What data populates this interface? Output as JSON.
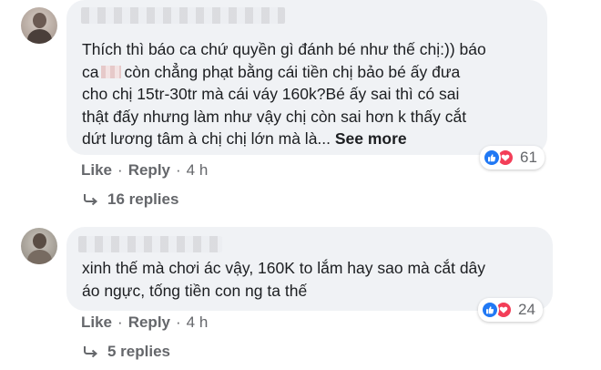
{
  "comments": [
    {
      "author_blurred": true,
      "text_part1": "Thích thì báo ca chứ quyền gì đánh bé như thế chị:)) báo\nca",
      "text_part2": "còn chẳng phạt bằng cái tiền chị bảo bé ấy đưa\ncho chị 15tr-30tr mà cái váy 160k?Bé ấy sai thì có sai\nthật đấy nhưng làm như vậy chị còn sai hơn k thấy cắt\ndứt lương tâm à chị chị lớn mà là... ",
      "see_more": "See more",
      "reaction_count": "61",
      "like": "Like",
      "reply": "Reply",
      "time": "4 h",
      "replies": "16 replies"
    },
    {
      "author_blurred": true,
      "text": "xinh thế mà chơi ác vậy, 160K to lắm hay sao mà cắt dây\náo ngực, tống tiền con ng ta thế",
      "reaction_count": "24",
      "like": "Like",
      "reply": "Reply",
      "time": "4 h",
      "replies": "5 replies"
    }
  ],
  "colors": {
    "bubble": "#f0f2f5",
    "like": "#2078f4",
    "love": "#f33e58",
    "meta_text": "#65676b"
  },
  "icons": {
    "like": "like-icon",
    "love": "love-icon",
    "reply_arrow": "reply-arrow-icon"
  }
}
